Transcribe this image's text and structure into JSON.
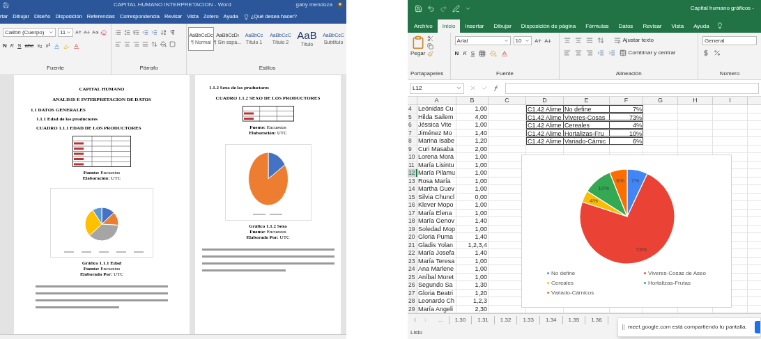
{
  "word": {
    "title": "CAPITAL HUMANO INTERPRETACION - Word",
    "user": "gaby mendoza",
    "tabs": [
      "rtar",
      "Dibujar",
      "Diseño",
      "Disposición",
      "Referencias",
      "Correspondencia",
      "Revisar",
      "Vista",
      "Zotero",
      "Ayuda"
    ],
    "search": "¿Qué desea hacer?",
    "font_name": "Calibri (Cuerpo)",
    "font_size": "11",
    "font_buttons": [
      "N",
      "K",
      "S",
      "abc",
      "x₂",
      "x²"
    ],
    "styles": [
      {
        "sample": "AaBbCcDc",
        "label": "¶ Normal",
        "selected": true
      },
      {
        "sample": "AaBbCcDı",
        "label": "¶ Sin espa...",
        "selected": false
      },
      {
        "sample": "AaBbCc",
        "label": "Título 1",
        "selected": false
      },
      {
        "sample": "AaBbCcC",
        "label": "Título 2",
        "selected": false
      },
      {
        "sample": "AaB",
        "label": "Título",
        "selected": false
      },
      {
        "sample": "AaBbCcC",
        "label": "Subtítulo",
        "selected": false
      }
    ],
    "groups": [
      "Fuente",
      "Párrafo",
      "Estilos"
    ],
    "pages": [
      [
        {
          "kind": "title",
          "text": "CAPITAL HUMANO"
        },
        {
          "kind": "title",
          "text": "ANALISIS E INTERPRETACION DE DATOS"
        },
        {
          "kind": "section",
          "text": "1.1 DATOS GENERALES"
        },
        {
          "kind": "subsection",
          "text": "1.1.1  Edad de los productores"
        },
        {
          "kind": "subsection",
          "text": "CUADRO 1.1.1 EDAD DE LOS PRODUCTORES"
        },
        {
          "kind": "age-table"
        },
        {
          "kind": "source",
          "lines": [
            "**Fuente:** Encuestas",
            "**Elaboración:** UTC"
          ]
        },
        {
          "kind": "age-pie"
        },
        {
          "kind": "source",
          "lines": [
            "**Gráfico 1.1.1 Edad**",
            "**Fuente:** Encuestas",
            "**Elaborado Por:** UTC"
          ]
        },
        {
          "kind": "text-lines"
        }
      ],
      [
        {
          "kind": "subsection",
          "text": "1.1.2  Sexo de los productores"
        },
        {
          "kind": "title",
          "text": "CUADRO 1.1.2 SEXO DE LOS PRODUCTORES"
        },
        {
          "kind": "sex-table"
        },
        {
          "kind": "source",
          "lines": [
            "**Fuente:** Encuestas",
            "**Elaboración:** UTC"
          ]
        },
        {
          "kind": "sex-pie"
        },
        {
          "kind": "source",
          "lines": [
            "**Gráfico 1.1.2 Sexo**",
            "**Fuente:** Encuestas",
            "**Elaborado Por:** UTC"
          ]
        },
        {
          "kind": "text-lines"
        }
      ]
    ]
  },
  "excel": {
    "title": "Capital humano gráficos -",
    "tabs": [
      {
        "label": "Archivo",
        "selected": false
      },
      {
        "label": "Inicio",
        "selected": true
      },
      {
        "label": "Insertar",
        "selected": false
      },
      {
        "label": "Dibujar",
        "selected": false
      },
      {
        "label": "Disposición de página",
        "selected": false
      },
      {
        "label": "Fórmulas",
        "selected": false
      },
      {
        "label": "Datos",
        "selected": false
      },
      {
        "label": "Revisar",
        "selected": false
      },
      {
        "label": "Vista",
        "selected": false
      },
      {
        "label": "Ayuda",
        "selected": false
      }
    ],
    "paste": "Pegar",
    "font_name": "Arial",
    "font_size": "10",
    "font_buttons": [
      "N",
      "K",
      "S"
    ],
    "wrap": "Ajustar texto",
    "merge": "Combinar y centrar",
    "number_format": "General",
    "groups": [
      "Portapapeles",
      "Fuente",
      "Alineación",
      "Número"
    ],
    "name_box": "L12",
    "columns": [
      "A",
      "B",
      "C",
      "D",
      "E",
      "F",
      "G",
      "H",
      "I"
    ],
    "rows": [
      {
        "num": "4",
        "a": "Leónidas Cu",
        "b": "1,00",
        "d": "C1.42 Alime",
        "e": "No define",
        "f": "7%",
        "selected": false
      },
      {
        "num": "5",
        "a": "Hilda Sailem",
        "b": "4,00",
        "d": "C1.42 Alime",
        "e": "Viveres-Cosas",
        "f": "73%",
        "selected": false
      },
      {
        "num": "6",
        "a": "Jéssica Vite",
        "b": "1,00",
        "d": "C1.42 Alime",
        "e": "Cereales",
        "f": "4%",
        "selected": false
      },
      {
        "num": "7",
        "a": "Jiménez Mo",
        "b": "1,40",
        "d": "C1.42 Alime",
        "e": "Hortalizas-Fru",
        "f": "10%",
        "selected": false
      },
      {
        "num": "8",
        "a": "Marina Isabe",
        "b": "1,20",
        "d": "C1.42 Alime",
        "e": "Variado-Cárnic",
        "f": "6%",
        "selected": false
      },
      {
        "num": "9",
        "a": "Curi Masaba",
        "b": "2,00",
        "selected": false
      },
      {
        "num": "10",
        "a": "Lorena Mora",
        "b": "1,00",
        "selected": false
      },
      {
        "num": "11",
        "a": "María Lisintu",
        "b": "1,00",
        "selected": false
      },
      {
        "num": "12",
        "a": "María Pilamu",
        "b": "1,00",
        "selected": true
      },
      {
        "num": "13",
        "a": "Rosa María",
        "b": "1,00",
        "selected": false
      },
      {
        "num": "14",
        "a": "Martha Guev",
        "b": "1,00",
        "selected": false
      },
      {
        "num": "15",
        "a": "Silvia Chuncl",
        "b": "0,00",
        "selected": false
      },
      {
        "num": "16",
        "a": "Klever Mopo",
        "b": "1,00",
        "selected": false
      },
      {
        "num": "17",
        "a": "María Elena",
        "b": "1,00",
        "selected": false
      },
      {
        "num": "18",
        "a": "María Genov",
        "b": "1,40",
        "selected": false
      },
      {
        "num": "19",
        "a": "Soledad Mop",
        "b": "1,00",
        "selected": false
      },
      {
        "num": "20",
        "a": "Gloria Puma",
        "b": "1,40",
        "selected": false
      },
      {
        "num": "21",
        "a": "Gladis Yolan",
        "b": "1,2,3,4",
        "selected": false
      },
      {
        "num": "22",
        "a": "María Josefa",
        "b": "1,40",
        "selected": false
      },
      {
        "num": "23",
        "a": "María Teresa",
        "b": "1,00",
        "selected": false
      },
      {
        "num": "24",
        "a": "Ana Marlene",
        "b": "1,00",
        "selected": false
      },
      {
        "num": "25",
        "a": "Aníbal Moret",
        "b": "1,00",
        "selected": false
      },
      {
        "num": "26",
        "a": "Segundo Sa",
        "b": "1,30",
        "selected": false
      },
      {
        "num": "27",
        "a": "Gloria Beatri",
        "b": "1,20",
        "selected": false
      },
      {
        "num": "28",
        "a": "Leonardo Ch",
        "b": "1,2,3",
        "selected": false
      },
      {
        "num": "29",
        "a": "María Angeli",
        "b": "2,30",
        "selected": false
      }
    ],
    "chart": {
      "chart_data": {
        "type": "pie",
        "categories": [
          "No define",
          "Viveres-Cosas de Aseo",
          "Cereales",
          "Hortalizas-Frutas",
          "Variado-Cárnicos"
        ],
        "values": [
          7,
          73,
          4,
          10,
          6
        ],
        "colors": [
          "#4285f4",
          "#ea4335",
          "#fbbc04",
          "#34a853",
          "#ff6d01"
        ],
        "value_labels": [
          "7%",
          "73%",
          "4%",
          "10%",
          "6%"
        ]
      }
    },
    "sheet_tabs": [
      "...",
      "1.30",
      "1.31",
      "1.32",
      "1.33",
      "1.34",
      "1.35",
      "1.36"
    ],
    "share_notice": "meet.google.com está compartiendo tu pantalla.",
    "status": "Listo"
  }
}
